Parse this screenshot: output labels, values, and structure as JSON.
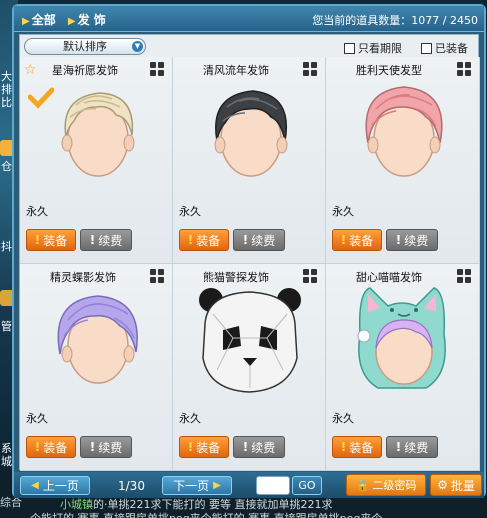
{
  "header": {
    "crumb_all": "全部",
    "crumb_category": "发 饰",
    "count_label": "您当前的道具数量：1077 / 2450"
  },
  "toolbar": {
    "sort_value": "默认排序",
    "only_expired": "只看期限",
    "equipped": "已装备"
  },
  "items": [
    {
      "name": "星海祈愿发饰",
      "duration": "永久",
      "equip": "装备",
      "renew": "续费"
    },
    {
      "name": "清风流年发饰",
      "duration": "永久",
      "equip": "装备",
      "renew": "续费"
    },
    {
      "name": "胜利天使发型",
      "duration": "永久",
      "equip": "装备",
      "renew": "续费"
    },
    {
      "name": "精灵蝶影发饰",
      "duration": "永久",
      "equip": "装备",
      "renew": "续费"
    },
    {
      "name": "熊猫警探发饰",
      "duration": "永久",
      "equip": "装备",
      "renew": "续费"
    },
    {
      "name": "甜心喵喵发饰",
      "duration": "永久",
      "equip": "装备",
      "renew": "续费"
    }
  ],
  "footer": {
    "prev": "上一页",
    "page": "1/30",
    "next": "下一页",
    "go": "GO",
    "password": "二级密码",
    "batch": "批量"
  },
  "chat": {
    "line1_prefix": "小城镇",
    "line1": "的·单挑221求下能打的 要等 直接就加单挑221求",
    "line2": "个能打的  赛事  直接跟房单挑pog来个能打的  赛事  直接跟房单挑pog来个"
  },
  "side": {
    "t1": "大排比",
    "t2": "仓",
    "t3": "抖",
    "t4": "管",
    "t5": "系城",
    "t6": "综合"
  }
}
